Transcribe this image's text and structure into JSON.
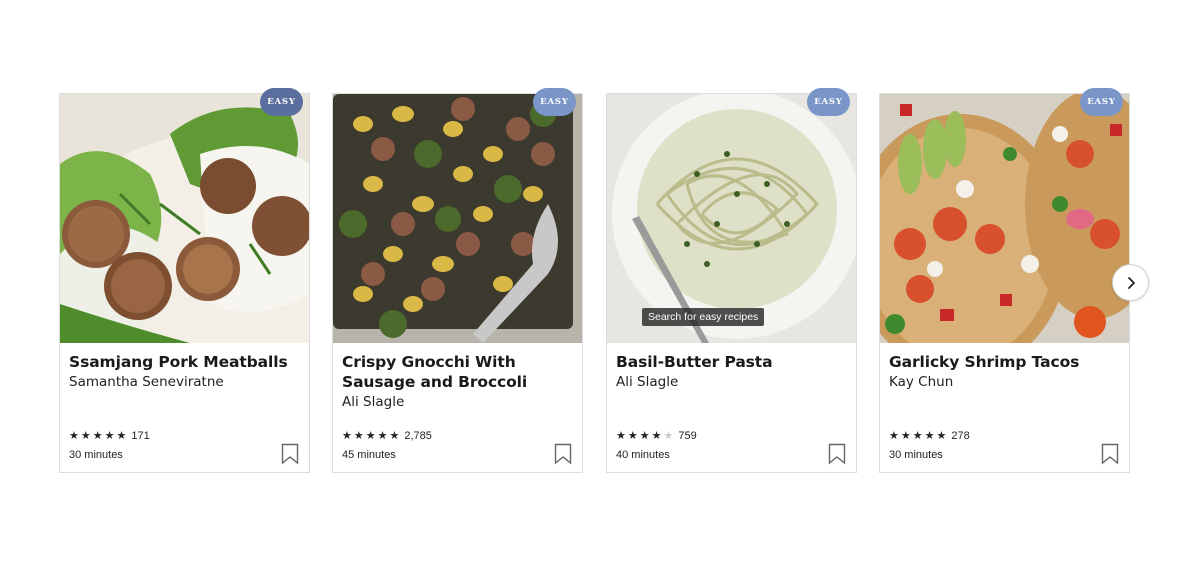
{
  "carousel": {
    "cards": [
      {
        "badge": "EASY",
        "title": "Ssamjang Pork Meatballs",
        "author": "Samantha Seneviratne",
        "rating": 5,
        "rating_count": "171",
        "time": "30 minutes",
        "image": "pork-meatballs-lettuce-wraps"
      },
      {
        "badge": "EASY",
        "title": "Crispy Gnocchi With Sausage and Broccoli",
        "author": "Ali Slagle",
        "rating": 5,
        "rating_count": "2,785",
        "time": "45 minutes",
        "image": "sheet-pan-gnocchi"
      },
      {
        "badge": "EASY",
        "title": "Basil-Butter Pasta",
        "author": "Ali Slagle",
        "rating": 4,
        "rating_count": "759",
        "time": "40 minutes",
        "image": "basil-pasta-plate",
        "tooltip": "Search for easy recipes"
      },
      {
        "badge": "EASY",
        "title": "Garlicky Shrimp Tacos",
        "author": "Kay Chun",
        "rating": 5,
        "rating_count": "278",
        "time": "30 minutes",
        "image": "shrimp-tacos"
      }
    ],
    "next_icon": "chevron-right-icon"
  },
  "colors": {
    "badge_1": "#5a6f9e",
    "badge_2": "#7a96c8",
    "badge_3": "#7a96c8",
    "badge_4": "#7a96c8",
    "star": "#222222",
    "star_empty": "#c8c8c8",
    "border": "#dcdcdc"
  }
}
